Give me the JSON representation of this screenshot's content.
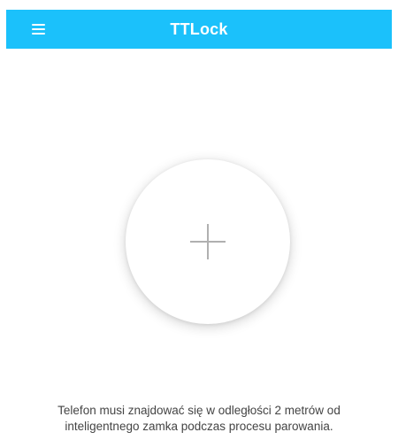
{
  "header": {
    "title": "TTLock",
    "menu_icon": "hamburger-menu-icon",
    "background_color": "#1bc1fb"
  },
  "main": {
    "add_button_icon": "plus-icon",
    "hint_line1": "Telefon musi znajdować się w odległości 2 metrów od",
    "hint_line2": "inteligentnego zamka podczas procesu parowania."
  }
}
